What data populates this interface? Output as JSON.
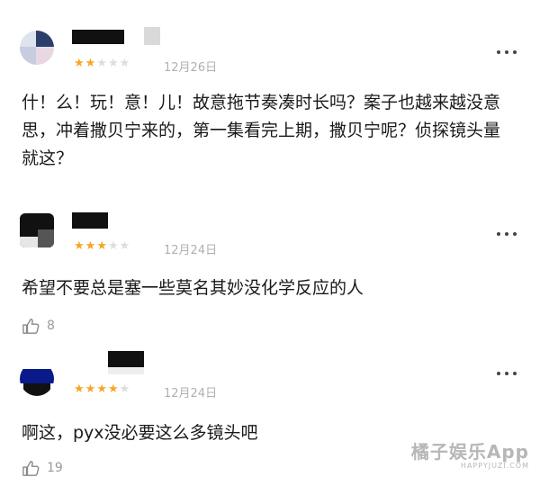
{
  "comments": [
    {
      "rating": 2,
      "stars_total": 5,
      "date": "12月26日",
      "text": "什！么！玩！意！儿！故意拖节奏凑时长吗？案子也越来越没意思，冲着撒贝宁来的，第一集看完上期，撒贝宁呢？侦探镜头量就这？",
      "likes": null
    },
    {
      "rating": 3,
      "stars_total": 5,
      "date": "12月24日",
      "text": "希望不要总是塞一些莫名其妙没化学反应的人",
      "likes": "8"
    },
    {
      "rating": 4,
      "stars_total": 5,
      "date": "12月24日",
      "text": "啊这，pyx没必要这么多镜头吧",
      "likes": "19"
    }
  ],
  "icons": {
    "star": "star-icon",
    "more": "more-dots-icon",
    "like": "thumbs-up-icon"
  },
  "colors": {
    "star_on": "#f5a623",
    "star_off": "#dddddd",
    "date": "#b0b0b0",
    "watermark": "#aaaaaa"
  },
  "watermark": {
    "main": "橘子娱乐App",
    "sub": "HAPPYJUZI.COM"
  }
}
